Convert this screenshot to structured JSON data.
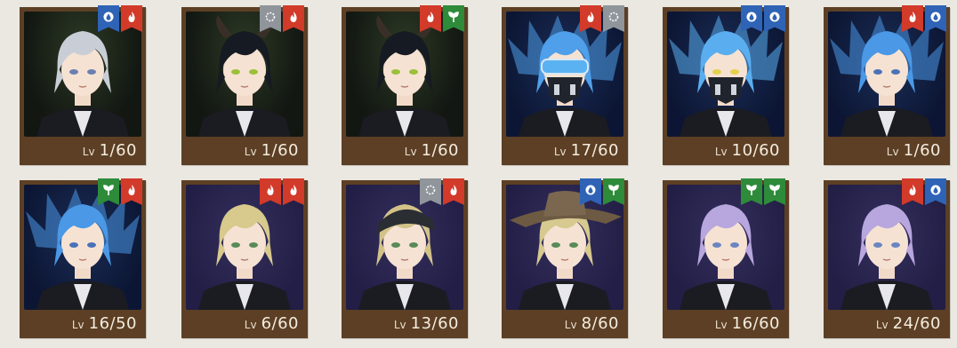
{
  "level_prefix": "Lv",
  "colors": {
    "fire": "#d23a2a",
    "water": "#2f63b6",
    "flora": "#2e8b3a",
    "neutral": "#8f959b",
    "frame": "#5c3f24"
  },
  "cards": [
    {
      "level": "1/60",
      "badges": [
        "water",
        "fire"
      ],
      "portrait": "silver-hair"
    },
    {
      "level": "1/60",
      "badges": [
        "neutral",
        "fire"
      ],
      "portrait": "black-hair-horns"
    },
    {
      "level": "1/60",
      "badges": [
        "fire",
        "flora"
      ],
      "portrait": "black-hair-horns"
    },
    {
      "level": "17/60",
      "badges": [
        "fire",
        "neutral"
      ],
      "portrait": "blue-flame-hair-mask-goggles"
    },
    {
      "level": "10/60",
      "badges": [
        "water",
        "water"
      ],
      "portrait": "blue-flame-hair-mask"
    },
    {
      "level": "1/60",
      "badges": [
        "fire",
        "water"
      ],
      "portrait": "blue-flame-hair"
    },
    {
      "level": "16/50",
      "badges": [
        "flora",
        "fire"
      ],
      "portrait": "blue-flame-hair"
    },
    {
      "level": "6/60",
      "badges": [
        "fire",
        "fire"
      ],
      "portrait": "blonde-bob"
    },
    {
      "level": "13/60",
      "badges": [
        "neutral",
        "fire"
      ],
      "portrait": "blonde-bandana"
    },
    {
      "level": "8/60",
      "badges": [
        "water",
        "flora"
      ],
      "portrait": "blonde-hat"
    },
    {
      "level": "16/60",
      "badges": [
        "flora",
        "flora"
      ],
      "portrait": "lavender-hair"
    },
    {
      "level": "24/60",
      "badges": [
        "fire",
        "water"
      ],
      "portrait": "lavender-hair"
    }
  ]
}
